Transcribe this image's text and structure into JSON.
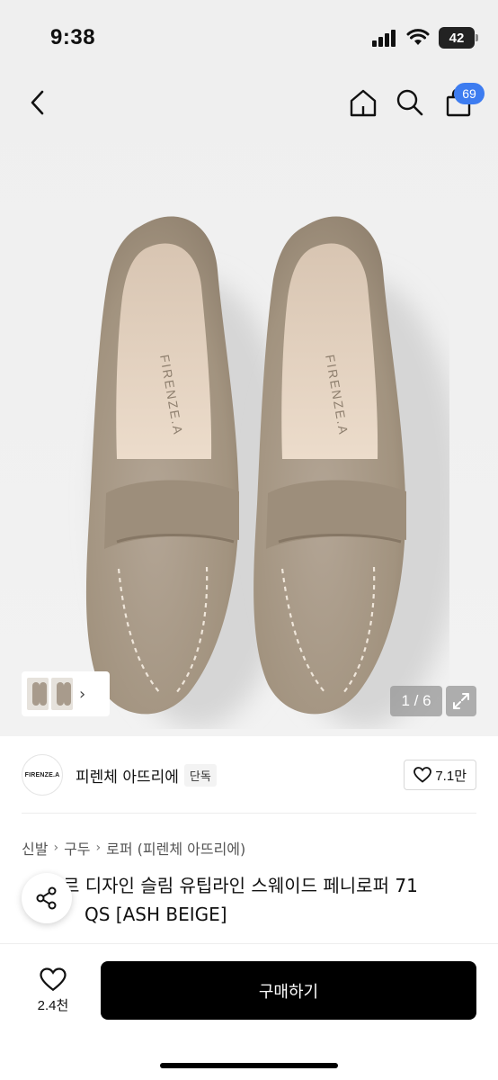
{
  "status_bar": {
    "time": "9:38",
    "battery": "42"
  },
  "header": {
    "icons": [
      "chevron-left-icon",
      "home-icon",
      "search-icon",
      "shopping-bag-icon"
    ],
    "cart_count": "69"
  },
  "gallery": {
    "page_indicator": "1 / 6",
    "insole_brand": "FIRENZE.A",
    "thumbnail_icon": "chevron-right-icon",
    "expand_icon": "expand-icon"
  },
  "brand": {
    "logo_text": "FIRENZE.A",
    "name": "피렌체 아뜨리에",
    "badge": "단독",
    "likes": "7.1만"
  },
  "breadcrumb": [
    "신발",
    "구두",
    "로퍼 (피렌체 아뜨리에)"
  ],
  "product": {
    "title_line1": "르 디자인 슬림 유팁라인 스웨이드 페니로퍼 71",
    "title_line2": "QS [ASH BEIGE]"
  },
  "bottom_bar": {
    "wish_count": "2.4천",
    "buy_label": "구매하기"
  },
  "colors": {
    "accent": "#3d7cf0",
    "suede": "#a89a8a",
    "buy_button": "#000000"
  }
}
